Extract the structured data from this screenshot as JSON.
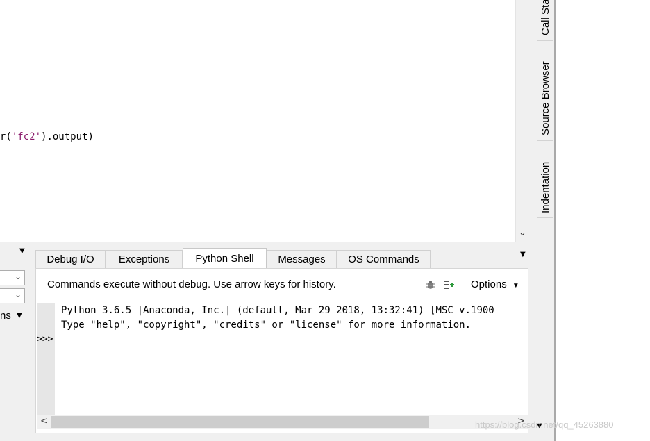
{
  "editor": {
    "code_prefix": "r(",
    "code_string": "'fc2'",
    "code_suffix": ").output)"
  },
  "left_pane": {
    "label_fragment": "ns"
  },
  "tabs": [
    {
      "label": "Debug I/O",
      "active": false
    },
    {
      "label": "Exceptions",
      "active": false
    },
    {
      "label": "Python Shell",
      "active": true
    },
    {
      "label": "Messages",
      "active": false
    },
    {
      "label": "OS Commands",
      "active": false
    }
  ],
  "shell": {
    "hint": "Commands execute without debug.  Use arrow keys for history.",
    "options_label": "Options",
    "lines": [
      "Python 3.6.5 |Anaconda, Inc.| (default, Mar 29 2018, 13:32:41) [MSC v.1900",
      "Type \"help\", \"copyright\", \"credits\" or \"license\" for more information."
    ],
    "prompt": ">>>"
  },
  "right_tabs": [
    {
      "label": "Call Stack"
    },
    {
      "label": "Source Browser"
    },
    {
      "label": "Indentation"
    }
  ],
  "watermark": "https://blog.csdn.net/qq_45263880",
  "colors": {
    "string": "#8b1a6b",
    "accent_green": "#2e9a3d"
  }
}
